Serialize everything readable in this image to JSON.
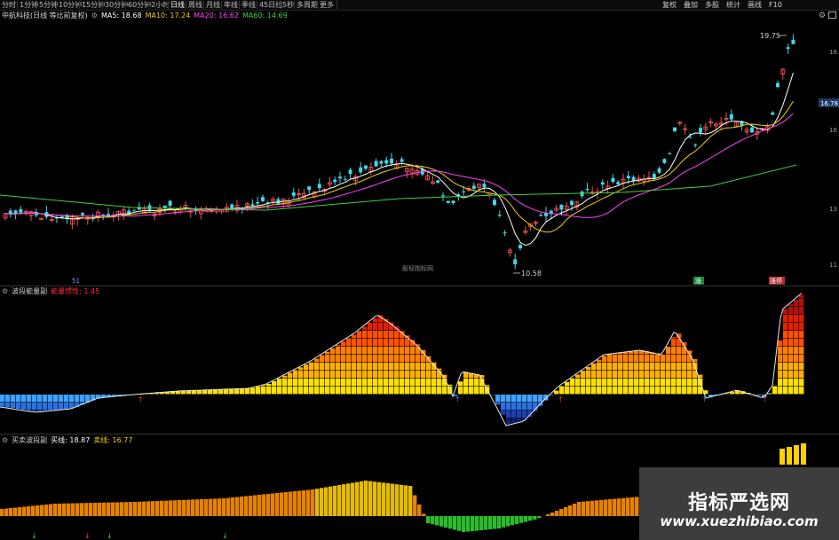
{
  "toolbar": {
    "tabs": [
      "分时",
      "1分钟",
      "5分钟",
      "10分钟",
      "15分钟",
      "30分钟",
      "60分钟",
      "2小时",
      "日线",
      "周线",
      "月线",
      "年线",
      "季线",
      "45日线",
      "5秒",
      "多周期",
      "更多"
    ],
    "active_tab": "日线",
    "right_tabs": [
      "复权",
      "叠加",
      "多股",
      "统计",
      "画线",
      "F10"
    ],
    "settings_icon": "gear-icon",
    "window_icon": "window-icon"
  },
  "main_panel": {
    "title": "中航科技(日线 等比前复权)",
    "ma_items": [
      {
        "label": "MA5: 18.68",
        "color": "#ffffff"
      },
      {
        "label": "MA10: 17.24",
        "color": "#f0d000"
      },
      {
        "label": "MA20: 16.62",
        "color": "#ff40ff"
      },
      {
        "label": "MA60: 14.69",
        "color": "#40d040"
      }
    ],
    "high_label": "19.75",
    "low_label": "10.58",
    "price_tag": "16.78",
    "center_watermark": "股轻指标网",
    "markers": [
      "51",
      "涨",
      "涨停"
    ]
  },
  "panel2": {
    "title": "波段能量副",
    "item": "能量惯性: 1.45",
    "item_color": "#ff3030"
  },
  "panel3": {
    "title": "买卖波段副",
    "buy_label": "买线: 18.87",
    "sell_label": "卖线: 16.77",
    "buy_color": "#ffffff",
    "sell_color": "#f0d000"
  },
  "watermark": {
    "title": "指标严选网",
    "url": "www.xuezhibiao.com"
  },
  "colors": {
    "up": "#f05050",
    "down": "#40d8e8",
    "ma5": "#ffffff",
    "ma10": "#f0d000",
    "ma20": "#ff40ff",
    "ma60": "#40d040"
  }
}
